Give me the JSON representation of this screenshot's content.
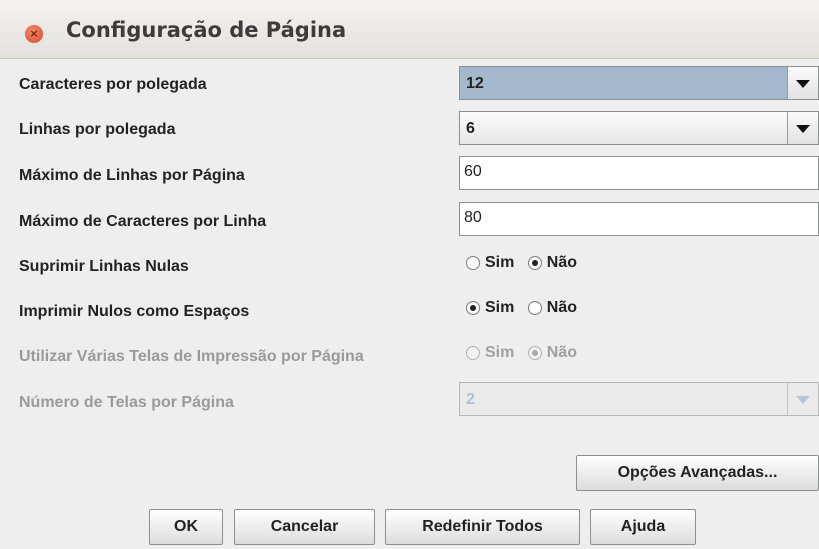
{
  "window": {
    "title": "Configuração de Página",
    "close_glyph": "×"
  },
  "fields": {
    "chars_per_inch": {
      "label": "Caracteres por polegada",
      "value": "12"
    },
    "lines_per_inch": {
      "label": "Linhas por polegada",
      "value": "6"
    },
    "max_lines_page": {
      "label": "Máximo de Linhas por Página",
      "value": "60"
    },
    "max_chars_line": {
      "label": "Máximo de Caracteres por Linha",
      "value": "80"
    },
    "suppress_null_lines": {
      "label": "Suprimir Linhas Nulas",
      "yes": "Sim",
      "no": "Não",
      "selected": "no"
    },
    "print_nulls_as_spaces": {
      "label": "Imprimir Nulos como Espaços",
      "yes": "Sim",
      "no": "Não",
      "selected": "yes"
    },
    "multi_screens": {
      "label": "Utilizar Várias Telas de Impressão por Página",
      "yes": "Sim",
      "no": "Não",
      "selected": "no",
      "disabled": true
    },
    "screens_per_page": {
      "label": "Número de Telas por Página",
      "value": "2",
      "disabled": true
    }
  },
  "buttons": {
    "advanced": "Opções Avançadas...",
    "ok": "OK",
    "cancel": "Cancelar",
    "reset_all": "Redefinir Todos",
    "help": "Ajuda"
  }
}
